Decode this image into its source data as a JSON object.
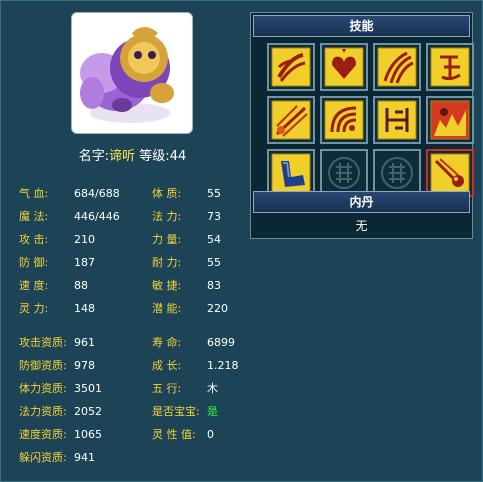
{
  "header": {
    "name_label": "名字:",
    "name_value": "谛听",
    "level_label": "等级:",
    "level_value": "44"
  },
  "stats_left": [
    {
      "label": "气    血:",
      "value": "684/688"
    },
    {
      "label": "魔    法:",
      "value": "446/446"
    },
    {
      "label": "攻    击:",
      "value": "210"
    },
    {
      "label": "防    御:",
      "value": "187"
    },
    {
      "label": "速    度:",
      "value": "88"
    },
    {
      "label": "灵    力:",
      "value": "148"
    }
  ],
  "stats_right": [
    {
      "label": "体    质:",
      "value": "55"
    },
    {
      "label": "法    力:",
      "value": "73"
    },
    {
      "label": "力    量:",
      "value": "54"
    },
    {
      "label": "耐    力:",
      "value": "55"
    },
    {
      "label": "敏    捷:",
      "value": "83"
    },
    {
      "label": "潜    能:",
      "value": "220"
    }
  ],
  "aptitudes_left": [
    {
      "label": "攻击资质:",
      "value": "961"
    },
    {
      "label": "防御资质:",
      "value": "978"
    },
    {
      "label": "体力资质:",
      "value": "3501"
    },
    {
      "label": "法力资质:",
      "value": "2052"
    },
    {
      "label": "速度资质:",
      "value": "1065"
    },
    {
      "label": "躲闪资质:",
      "value": "941"
    }
  ],
  "aptitudes_right": [
    {
      "label": "寿    命:",
      "value": "6899"
    },
    {
      "label": "成    长:",
      "value": "1.218"
    },
    {
      "label": "五    行:",
      "value": "木"
    },
    {
      "label": "是否宝宝:",
      "value": "是"
    },
    {
      "label": "灵 性 值:",
      "value": "0"
    }
  ],
  "skills_panel": {
    "title": "技能",
    "skills": [
      {
        "icon": "claw-slash-icon"
      },
      {
        "icon": "heart-shield-icon"
      },
      {
        "icon": "triple-claw-icon"
      },
      {
        "icon": "rune-script-icon"
      },
      {
        "icon": "fire-slash-icon"
      },
      {
        "icon": "sound-wave-icon"
      },
      {
        "icon": "fire-rune-icon"
      },
      {
        "icon": "burning-figure-icon"
      },
      {
        "icon": "armored-arm-icon"
      },
      {
        "icon": "empty-slot-icon"
      },
      {
        "icon": "empty-slot-icon"
      },
      {
        "icon": "meteor-icon"
      }
    ],
    "selected_index": 11
  },
  "neidan_panel": {
    "title": "内丹",
    "value": "无"
  },
  "colors": {
    "background": "#1c4456",
    "label_yellow": "#f4d23a",
    "yes_green": "#39f03a",
    "name_yellow": "#ffe94a"
  }
}
